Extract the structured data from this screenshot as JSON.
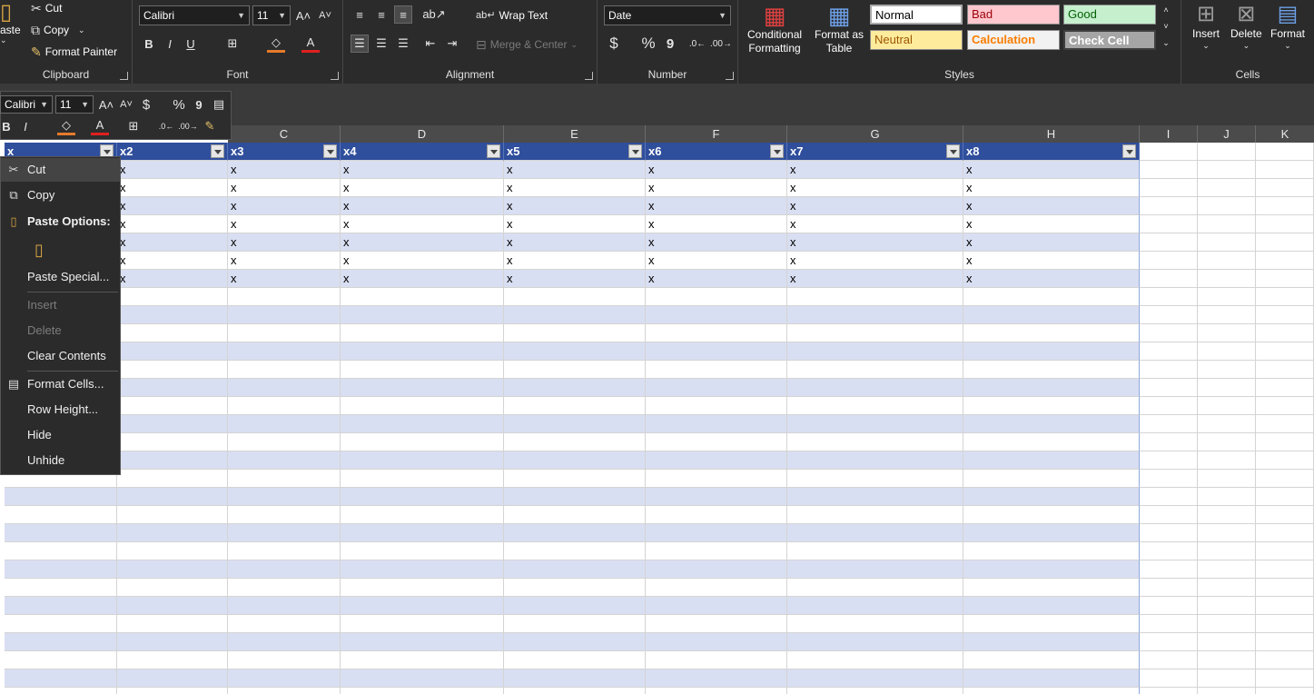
{
  "ribbon": {
    "clipboard": {
      "paste": "aste",
      "cut": "Cut",
      "copy": "Copy",
      "format_painter": "Format Painter",
      "label": "Clipboard"
    },
    "font": {
      "family": "Calibri",
      "size": "11",
      "bold": "B",
      "italic": "I",
      "underline": "U",
      "font_color_glyph": "A",
      "grow": "A",
      "shrink": "A",
      "label": "Font"
    },
    "alignment": {
      "wrap_text": "Wrap Text",
      "merge_center": "Merge & Center",
      "label": "Alignment"
    },
    "number": {
      "format": "Date",
      "currency": "$",
      "percent": "%",
      "comma": "9",
      "label": "Number"
    },
    "styles": {
      "conditional": [
        "Conditional",
        "Formatting"
      ],
      "format_as_table": [
        "Format as",
        "Table"
      ],
      "normal": "Normal",
      "bad": "Bad",
      "good": "Good",
      "neutral": "Neutral",
      "calculation": "Calculation",
      "check_cell": "Check Cell",
      "label": "Styles",
      "colors": {
        "bad_bg": "#ffc7ce",
        "bad_fg": "#9c0006",
        "good_bg": "#c6efce",
        "good_fg": "#006100",
        "neutral_bg": "#ffeb9c",
        "neutral_fg": "#9c5700",
        "calc_fg": "#fa7d00",
        "check_bg": "#a5a5a5"
      }
    },
    "cells": {
      "insert": "Insert",
      "delete": "Delete",
      "format": "Format",
      "label": "Cells"
    }
  },
  "mini_toolbar": {
    "font": "Calibri",
    "size": "11",
    "bold": "B",
    "italic": "I",
    "currency": "$",
    "percent": "%",
    "comma": "9"
  },
  "columns": [
    "C",
    "D",
    "E",
    "F",
    "G",
    "H",
    "I",
    "J",
    "K"
  ],
  "table": {
    "headers": [
      "x",
      "x2",
      "x3",
      "x4",
      "x5",
      "x6",
      "x7",
      "x8"
    ],
    "rows": [
      [
        "",
        "x",
        "x",
        "x",
        "x",
        "x",
        "x",
        "x"
      ],
      [
        "",
        "x",
        "x",
        "x",
        "x",
        "x",
        "x",
        "x"
      ],
      [
        "",
        "x",
        "x",
        "x",
        "x",
        "x",
        "x",
        "x"
      ],
      [
        "",
        "x",
        "x",
        "x",
        "x",
        "x",
        "x",
        "x"
      ],
      [
        "",
        "x",
        "x",
        "x",
        "x",
        "x",
        "x",
        "x"
      ],
      [
        "",
        "x",
        "x",
        "x",
        "x",
        "x",
        "x",
        "x"
      ],
      [
        "",
        "x",
        "x",
        "x",
        "x",
        "x",
        "x",
        "x"
      ]
    ],
    "header_color": "#2f4e9c",
    "band_color": "#d9dff2"
  },
  "context_menu": {
    "cut": "Cut",
    "copy": "Copy",
    "paste_options": "Paste Options:",
    "paste_special": "Paste Special...",
    "insert": "Insert",
    "delete": "Delete",
    "clear_contents": "Clear Contents",
    "format_cells": "Format Cells...",
    "row_height": "Row Height...",
    "hide": "Hide",
    "unhide": "Unhide"
  }
}
